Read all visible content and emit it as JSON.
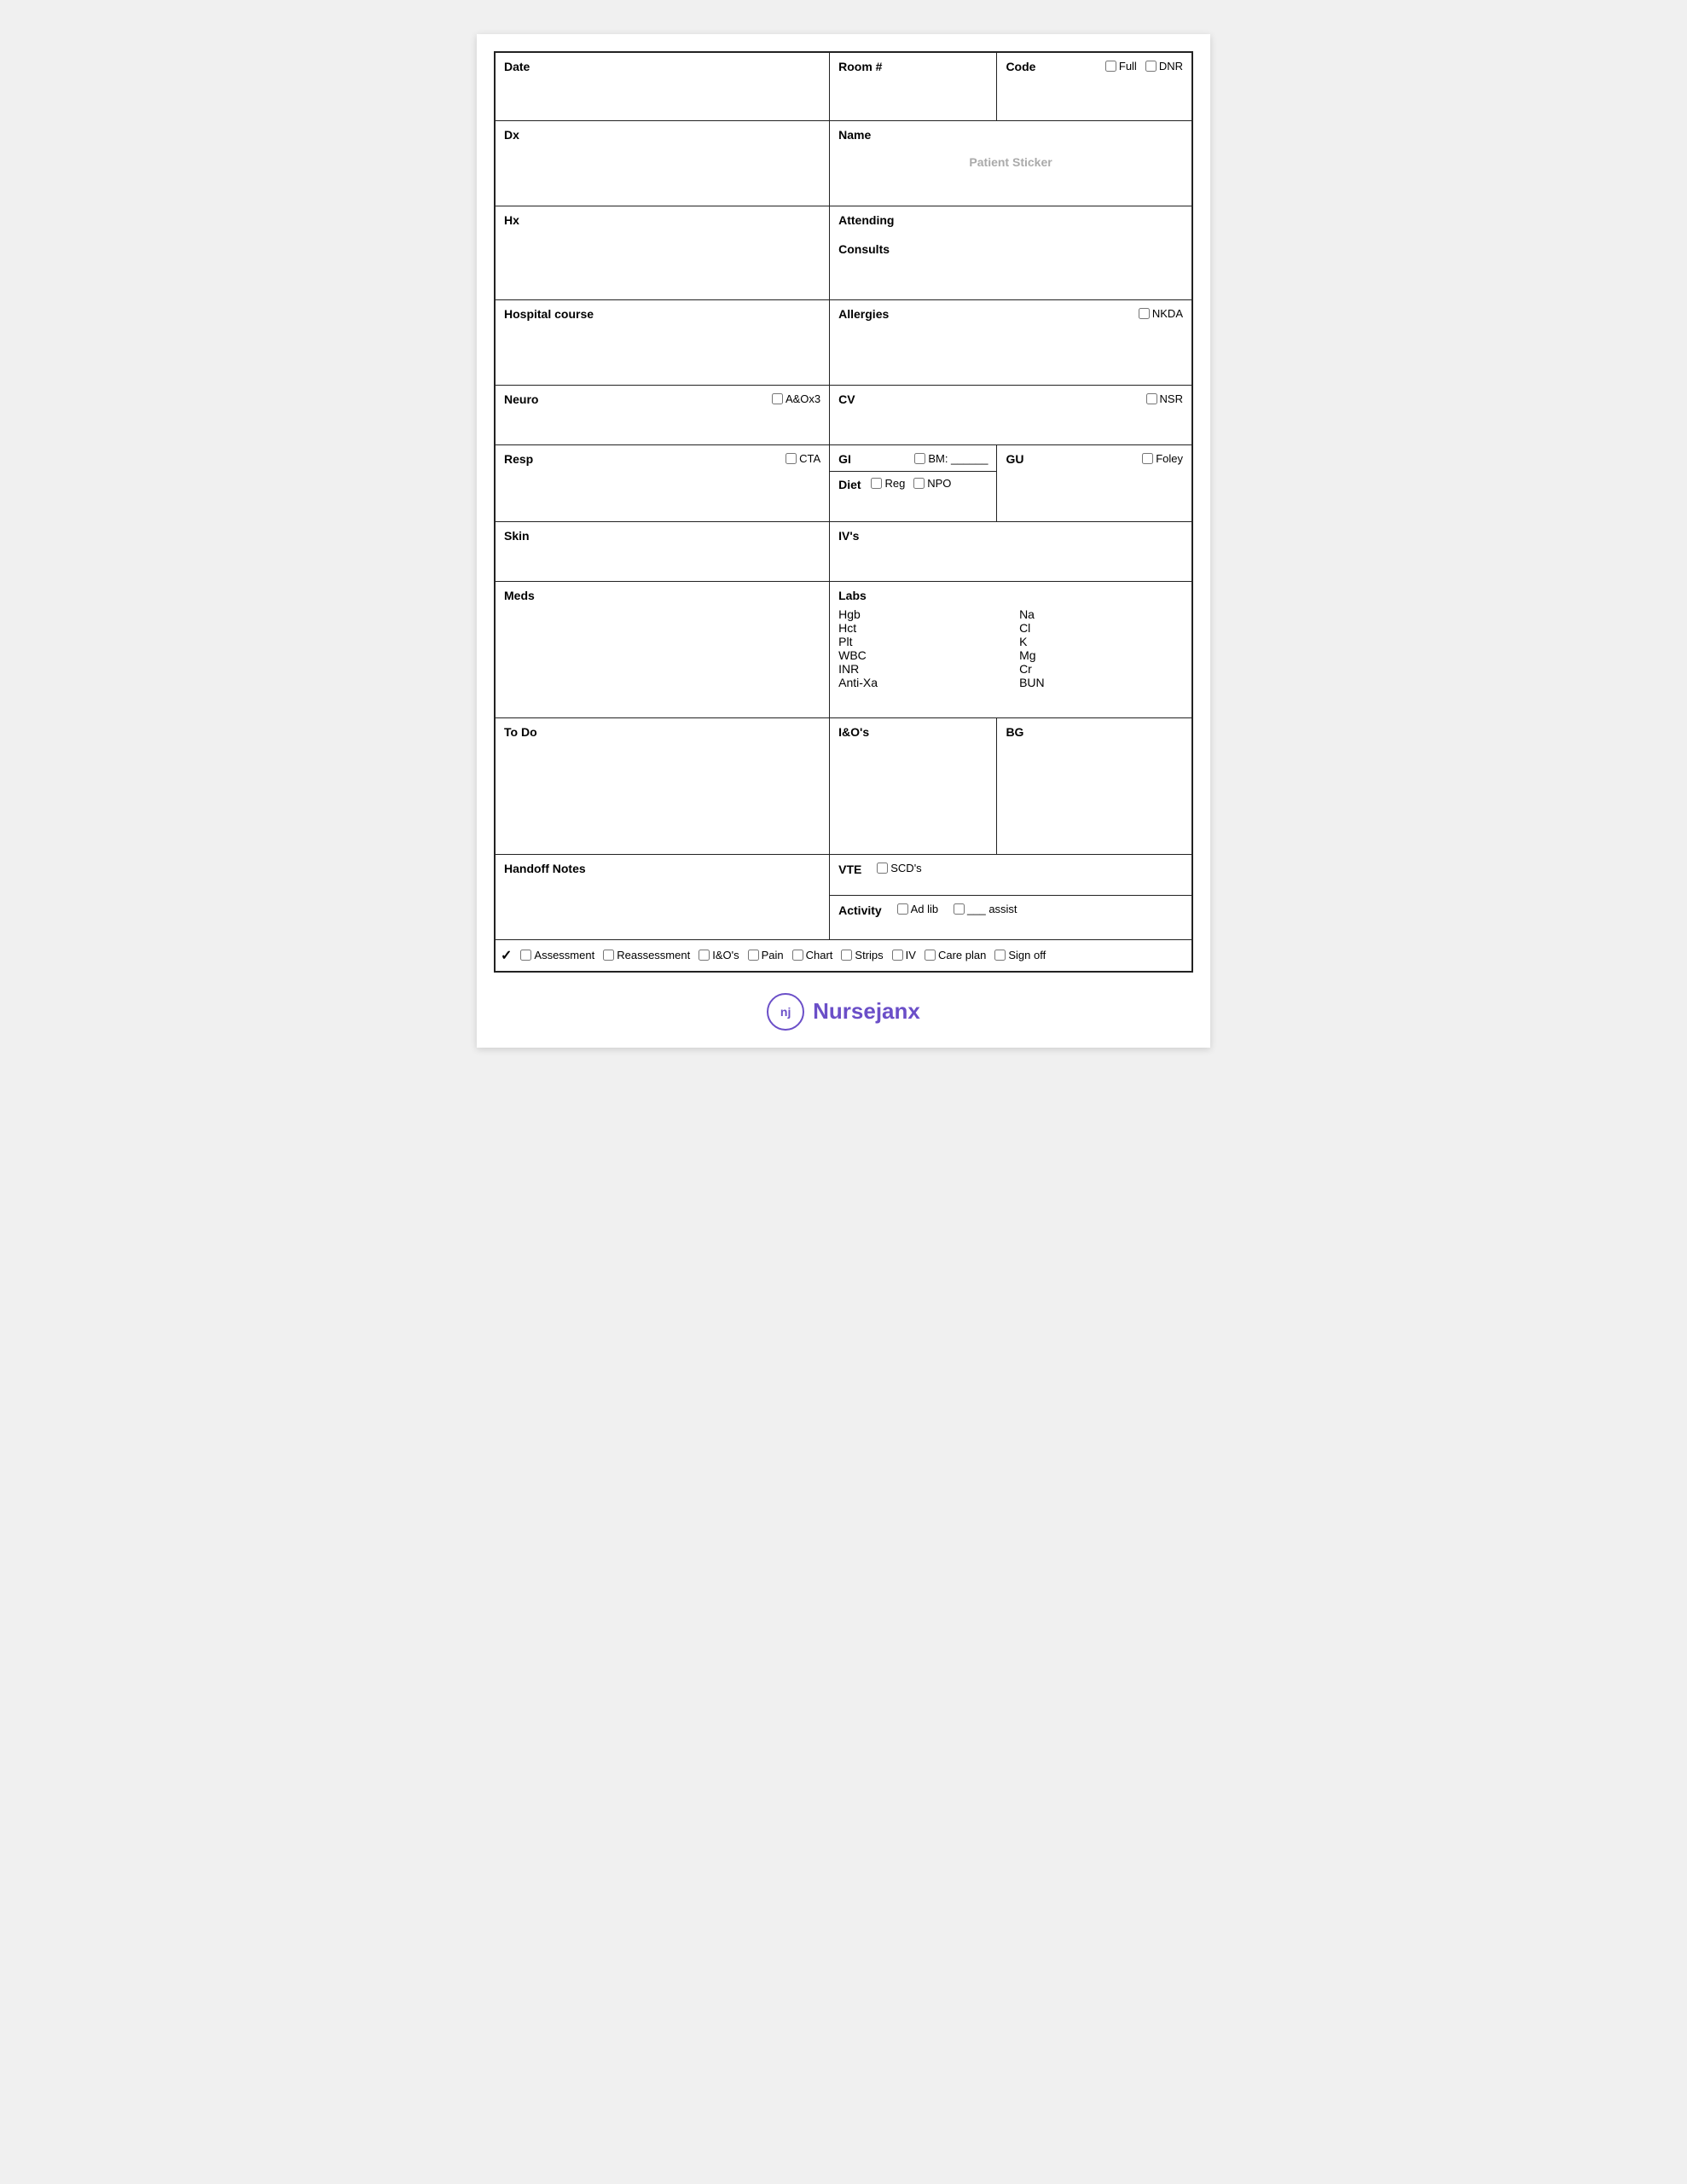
{
  "form": {
    "date_label": "Date",
    "room_label": "Room #",
    "code_label": "Code",
    "full_label": "Full",
    "dnr_label": "DNR",
    "dx_label": "Dx",
    "name_label": "Name",
    "patient_sticker": "Patient Sticker",
    "hx_label": "Hx",
    "attending_label": "Attending",
    "consults_label": "Consults",
    "hospital_course_label": "Hospital course",
    "allergies_label": "Allergies",
    "nkda_label": "NKDA",
    "neuro_label": "Neuro",
    "aox3_label": "A&Ox3",
    "cv_label": "CV",
    "nsr_label": "NSR",
    "resp_label": "Resp",
    "cta_label": "CTA",
    "gi_label": "GI",
    "bm_label": "BM: ______",
    "gu_label": "GU",
    "foley_label": "Foley",
    "diet_label": "Diet",
    "reg_label": "Reg",
    "npo_label": "NPO",
    "skin_label": "Skin",
    "ivs_label": "IV's",
    "meds_label": "Meds",
    "labs_label": "Labs",
    "labs_left": [
      "Hgb",
      "Hct",
      "Plt",
      "WBC",
      "INR",
      "Anti-Xa"
    ],
    "labs_right": [
      "Na",
      "Cl",
      "K",
      "Mg",
      "Cr",
      "BUN"
    ],
    "todo_label": "To Do",
    "ios_label": "I&O's",
    "bg_label": "BG",
    "handoff_label": "Handoff Notes",
    "vte_label": "VTE",
    "scds_label": "SCD's",
    "activity_label": "Activity",
    "adlib_label": "Ad lib",
    "assist_label": "___ assist",
    "footer": {
      "checkmark": "✓",
      "assessment_label": "Assessment",
      "reassessment_label": "Reassessment",
      "ios_label": "I&O's",
      "pain_label": "Pain",
      "chart_label": "Chart",
      "strips_label": "Strips",
      "iv_label": "IV",
      "careplan_label": "Care plan",
      "signoff_label": "Sign off"
    }
  },
  "logo": {
    "initials": "nj",
    "brand_text": "Nurse",
    "brand_accent": "janx"
  }
}
